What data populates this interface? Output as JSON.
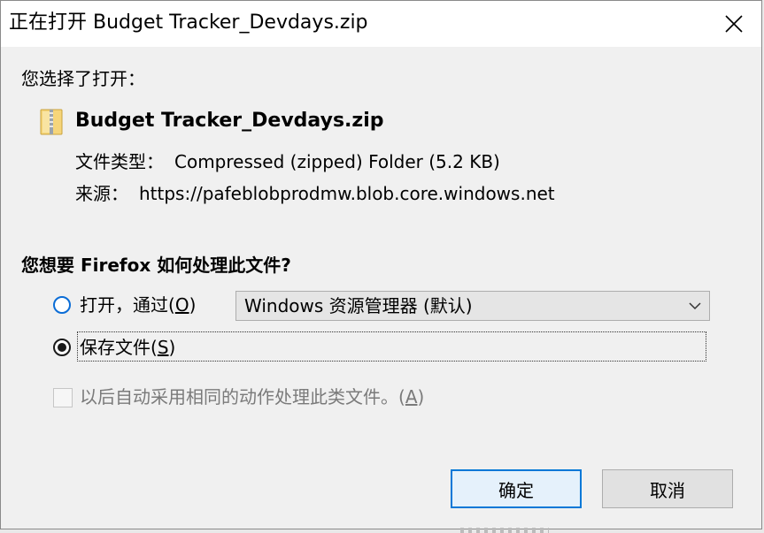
{
  "window": {
    "title": "正在打开 Budget Tracker_Devdays.zip",
    "close_icon": "close-icon"
  },
  "prompt": "您选择了打开：",
  "file": {
    "icon": "zip-folder-icon",
    "name": "Budget Tracker_Devdays.zip",
    "type_label": "文件类型：",
    "type_value": "Compressed (zipped) Folder (5.2 KB)",
    "source_label": "来源：",
    "source_value": "https://pafeblobprodmw.blob.core.windows.net"
  },
  "question": "您想要 Firefox 如何处理此文件?",
  "options": {
    "open": {
      "label_prefix": "打开，通过(",
      "accel": "O",
      "label_suffix": ")",
      "selected": false
    },
    "open_with": {
      "value": "Windows 资源管理器 (默认)"
    },
    "save": {
      "label_prefix": "保存文件(",
      "accel": "S",
      "label_suffix": ")",
      "selected": true
    }
  },
  "remember": {
    "label_prefix": "以后自动采用相同的动作处理此类文件。(",
    "accel": "A",
    "label_suffix": ")",
    "checked": false,
    "enabled": false
  },
  "buttons": {
    "ok": "确定",
    "cancel": "取消"
  },
  "colors": {
    "accent": "#0078d7",
    "dialog_bg": "#f0f0f0",
    "titlebar_bg": "#ffffff",
    "disabled_text": "#7a7a7a"
  }
}
